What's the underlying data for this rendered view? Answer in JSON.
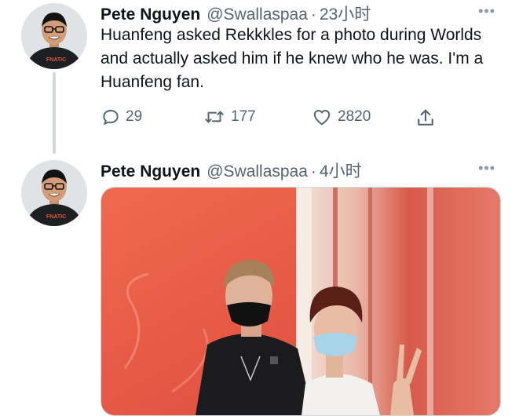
{
  "thread": {
    "first": {
      "author": {
        "name": "Pete Nguyen",
        "handle": "@Swallaspaa"
      },
      "separator": "·",
      "time": "23小时",
      "more": "•••",
      "text": "Huanfeng asked Rekkkles for a photo during Worlds and actually asked him if he knew who he was. I'm a Huanfeng fan.",
      "stats": {
        "replies": "29",
        "retweets": "177",
        "likes": "2820"
      }
    },
    "second": {
      "author": {
        "name": "Pete Nguyen",
        "handle": "@Swallaspaa"
      },
      "separator": "·",
      "time": "4小时",
      "more": "•••"
    }
  },
  "icons": [
    "reply-icon",
    "retweet-icon",
    "like-icon",
    "share-icon",
    "more-icon"
  ],
  "colors": {
    "muted": "#536471",
    "thread_line": "#cfd9de",
    "photo_bg": "#e4503f"
  }
}
